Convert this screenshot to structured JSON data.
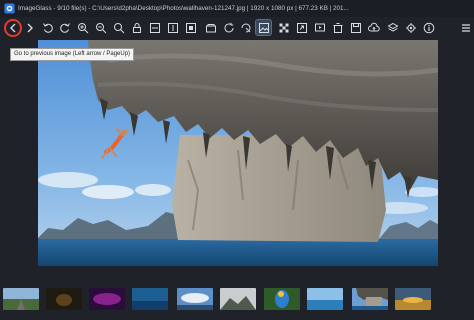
{
  "window": {
    "title": "ImageGlass - 9/10 file(s) - C:\\Users\\d2pha\\Desktop\\Photos\\wallhaven-121247.jpg | 1920 x 1080 px | 677.23 KB | 201..."
  },
  "tooltip": {
    "text": "Go to previous image (Left arrow / PageUp)"
  },
  "toolbar": {
    "buttons": [
      {
        "name": "previous-image-icon"
      },
      {
        "name": "next-image-icon"
      },
      {
        "name": "rotate-left-icon"
      },
      {
        "name": "rotate-right-icon"
      },
      {
        "name": "zoom-in-icon"
      },
      {
        "name": "zoom-out-icon"
      },
      {
        "name": "zoom-fit-icon"
      },
      {
        "name": "lock-zoom-icon"
      },
      {
        "name": "scale-to-width-icon"
      },
      {
        "name": "scale-to-height-icon"
      },
      {
        "name": "auto-zoom-icon"
      },
      {
        "name": "open-file-icon"
      },
      {
        "name": "refresh-icon"
      },
      {
        "name": "goto-image-icon"
      },
      {
        "name": "thumbnail-bar-icon"
      },
      {
        "name": "checkerboard-icon"
      },
      {
        "name": "fullscreen-icon"
      },
      {
        "name": "slideshow-icon"
      },
      {
        "name": "delete-icon"
      },
      {
        "name": "save-icon"
      },
      {
        "name": "print-icon"
      },
      {
        "name": "upload-icon"
      },
      {
        "name": "crop-icon"
      },
      {
        "name": "settings-icon"
      },
      {
        "name": "info-icon"
      },
      {
        "name": "menu-icon"
      }
    ],
    "accent_color": "#4d6f96",
    "highlight_color": "#e23b2f"
  },
  "thumbnails": [
    {
      "name": "thumbnail-road"
    },
    {
      "name": "thumbnail-dark-forest"
    },
    {
      "name": "thumbnail-purple-nebula"
    },
    {
      "name": "thumbnail-blue-sea"
    },
    {
      "name": "thumbnail-clouds-sky"
    },
    {
      "name": "thumbnail-mountain-mist"
    },
    {
      "name": "thumbnail-parrot"
    },
    {
      "name": "thumbnail-beach-horizon"
    },
    {
      "name": "thumbnail-climber-cliff",
      "selected": true
    },
    {
      "name": "thumbnail-sunset-field"
    }
  ]
}
